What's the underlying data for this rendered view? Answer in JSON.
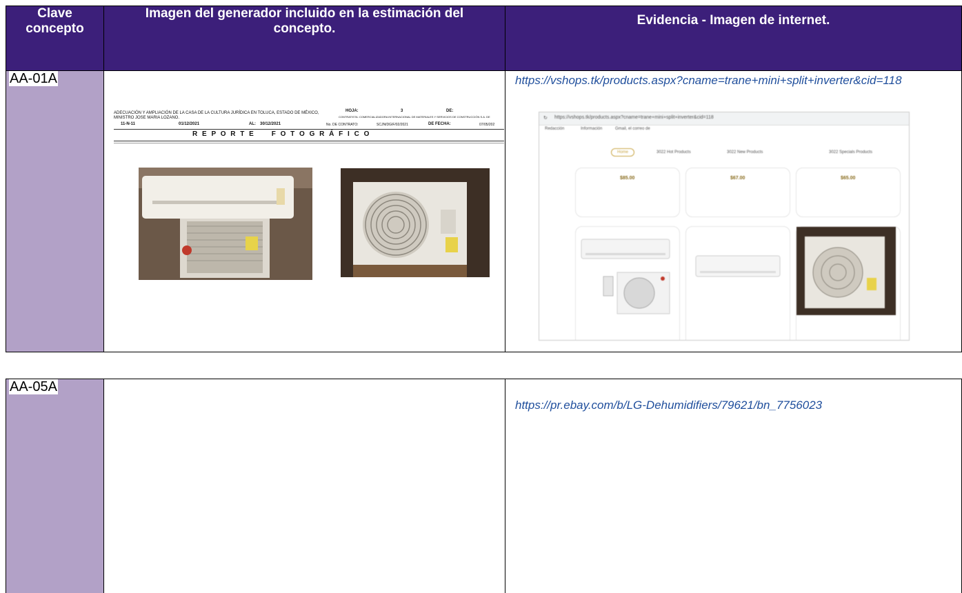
{
  "table_header": {
    "col1": "Clave concepto",
    "col2": "Imagen del generador incluido en la estimación del concepto.",
    "col3": "Evidencia - Imagen de internet."
  },
  "rows": [
    {
      "clave": "AA-01A",
      "link": "https://vshops.tk/products.aspx?cname=trane+mini+split+inverter&cid=118",
      "report": {
        "project": "ADECUACIÓN Y AMPLIACIÓN DE LA CASA DE LA CULTURA JURÍDICA EN TOLUCA, ESTADO DE MÉXICO, MINISTRO JOSE MARIA LOZANO.",
        "hoja_label": "HOJA:",
        "hoja_value": "3",
        "de_label": "DE:",
        "contratista": "CONTRATISTA: COMERCIALIZADORA INTERNACIONAL DE MATERIALES Y SERVICIOS DE CONSTRUCCIÓN S.A. DE",
        "code": "11-N-11",
        "date_from": "01/12/2021",
        "al_label": "AL:",
        "date_to": "30/12/2021",
        "contrato_label": "No. DE CONTRATO:",
        "contrato_value": "SCJN/DGIF/02/2021",
        "fecha_label": "DE FECHA:",
        "fecha_value": "07/05/202",
        "title": "R E P O R T E     F O T O G R Á F I C O"
      },
      "browser": {
        "url": "https://vshops.tk/products.aspx?cname=trane+mini+split+inverter&cid=118",
        "bookmarks": [
          "Redacción",
          "Información",
          "Gmail, el correo de"
        ],
        "nav": [
          "Home",
          "3022 Hot Products",
          "3022 New Products",
          "3022 Specials Products"
        ],
        "prices": [
          "$85.00",
          "$67.00",
          "$65.00"
        ]
      }
    },
    {
      "clave": "AA-05A",
      "link": "https://pr.ebay.com/b/LG-Dehumidifiers/79621/bn_7756023"
    }
  ]
}
